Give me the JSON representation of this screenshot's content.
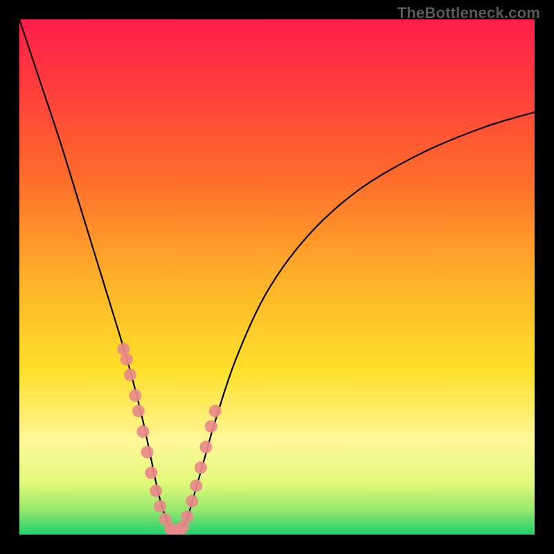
{
  "watermark": "TheBottleneck.com",
  "colors": {
    "frame": "#000000",
    "gradient_top": "#ff1e4a",
    "gradient_mid1": "#ff6a2b",
    "gradient_mid2": "#ffd92a",
    "gradient_mid3": "#fff79a",
    "gradient_bottom": "#21d06c",
    "curve": "#000000",
    "marker_fill": "#e98a8a",
    "marker_stroke": "#d47777"
  },
  "chart_data": {
    "type": "line",
    "title": "",
    "xlabel": "",
    "ylabel": "",
    "xlim": [
      0,
      100
    ],
    "ylim": [
      0,
      100
    ],
    "series": [
      {
        "name": "bottleneck-curve",
        "x": [
          0,
          4,
          8,
          12,
          16,
          20,
          22,
          24,
          25.5,
          27,
          28.5,
          30,
          31,
          32.5,
          34,
          36,
          38,
          42,
          48,
          56,
          66,
          78,
          90,
          100
        ],
        "y": [
          100,
          88,
          76,
          63,
          50,
          37,
          30,
          22,
          15,
          8,
          3,
          0.5,
          0.5,
          3,
          8,
          15,
          22,
          34,
          47,
          58,
          67,
          74,
          79,
          82
        ]
      }
    ],
    "markers": [
      {
        "name": "left-cluster",
        "x": [
          20.2,
          20.8,
          21.5,
          22.5,
          23.1,
          24.0,
          24.8,
          25.6,
          26.5,
          27.3,
          28.3,
          29.3,
          30.0
        ],
        "y": [
          36,
          34,
          31,
          27,
          24,
          20,
          16,
          12,
          8.5,
          5.5,
          3.0,
          1.2,
          0.7
        ]
      },
      {
        "name": "right-cluster",
        "x": [
          31.0,
          31.7,
          32.6,
          33.5,
          34.3,
          35.2,
          36.2,
          37.2,
          38.0
        ],
        "y": [
          0.7,
          1.5,
          3.5,
          6.5,
          9.5,
          13,
          17,
          21,
          24
        ]
      }
    ],
    "gradient_stops": [
      {
        "offset": 0.0,
        "color": "#ff1e4a"
      },
      {
        "offset": 0.12,
        "color": "#ff3a3e"
      },
      {
        "offset": 0.3,
        "color": "#ff6a2b"
      },
      {
        "offset": 0.5,
        "color": "#ffb02a"
      },
      {
        "offset": 0.68,
        "color": "#ffe02a"
      },
      {
        "offset": 0.82,
        "color": "#fff79a"
      },
      {
        "offset": 0.9,
        "color": "#e2f97a"
      },
      {
        "offset": 0.95,
        "color": "#9ae96f"
      },
      {
        "offset": 1.0,
        "color": "#21d06c"
      }
    ]
  }
}
